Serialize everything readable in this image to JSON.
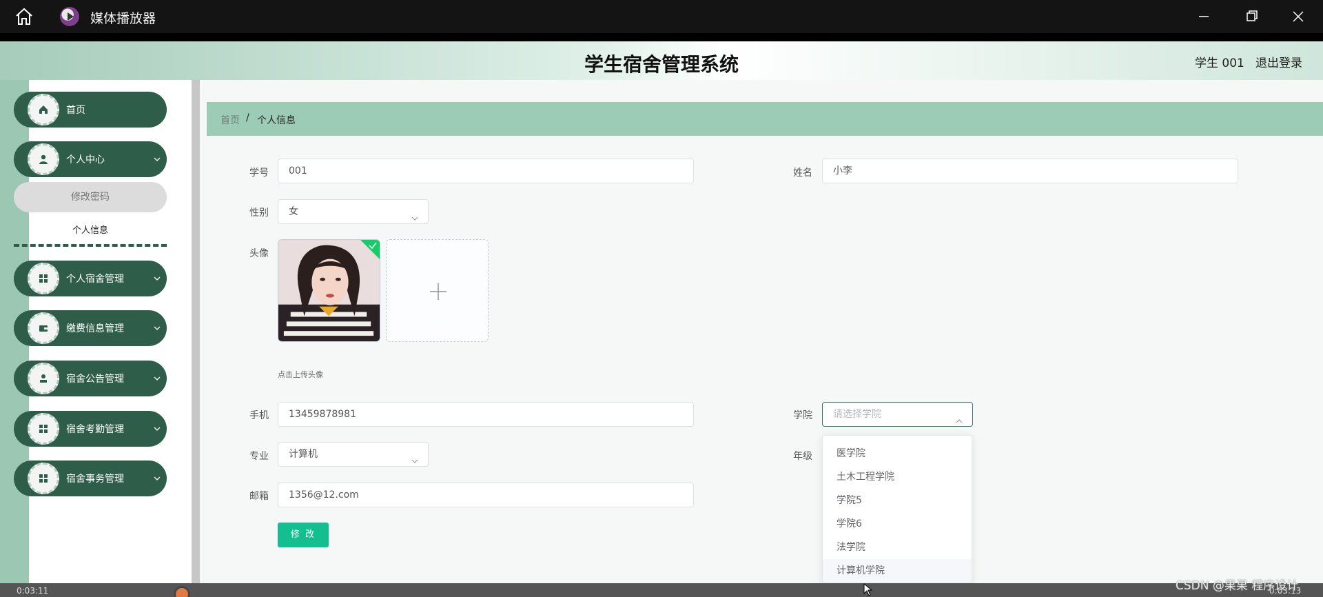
{
  "player": {
    "app_title": "媒体播放器",
    "time_elapsed": "0:03:11",
    "time_total": "0:03:13",
    "icons": [
      "home-icon",
      "minimize-icon",
      "maximize-icon",
      "close-icon"
    ]
  },
  "header": {
    "system_title": "学生宿舍管理系统",
    "user_label": "学生 001",
    "logout_label": "退出登录"
  },
  "sidebar": {
    "items": [
      {
        "label": "首页",
        "icon": "home-icon"
      },
      {
        "label": "个人中心",
        "icon": "user-icon"
      },
      {
        "label": "个人宿舍管理",
        "icon": "grid-icon"
      },
      {
        "label": "缴费信息管理",
        "icon": "wallet-icon"
      },
      {
        "label": "宿舍公告管理",
        "icon": "person-icon"
      },
      {
        "label": "宿舍考勤管理",
        "icon": "grid-icon"
      },
      {
        "label": "宿舍事务管理",
        "icon": "grid-icon"
      }
    ],
    "sub_items": [
      "修改密码",
      "个人信息"
    ]
  },
  "breadcrumb": {
    "home": "首页",
    "separator": "/",
    "current": "个人信息"
  },
  "form": {
    "student_id_label": "学号",
    "student_id_value": "001",
    "name_label": "姓名",
    "name_value": "小李",
    "gender_label": "性别",
    "gender_value": "女",
    "avatar_label": "头像",
    "upload_tip": "点击上传头像",
    "phone_label": "手机",
    "phone_value": "13459878981",
    "college_label": "学院",
    "college_placeholder": "请选择学院",
    "major_label": "专业",
    "major_value": "计算机",
    "grade_label": "年级",
    "email_label": "邮箱",
    "email_value": "1356@12.com",
    "submit_label": "修 改"
  },
  "college_options": [
    "医学院",
    "土木工程学院",
    "学院5",
    "学院6",
    "法学院",
    "计算机学院"
  ],
  "watermark": "CSDN @果果 程序设计",
  "colors": {
    "sidebar_green": "#2e5e49",
    "breadcrumb_bg": "#9ccbb6",
    "submit_green": "#14bf8f",
    "focus_border": "#2e7d5b"
  }
}
